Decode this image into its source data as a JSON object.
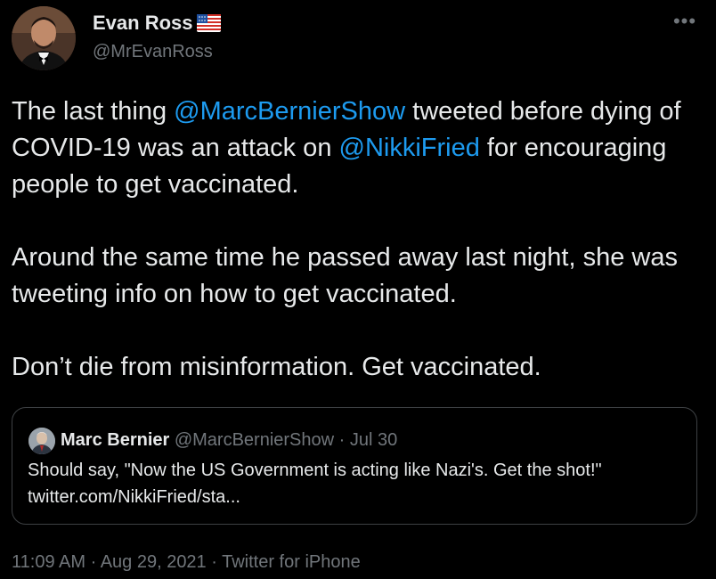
{
  "author": {
    "name": "Evan Ross",
    "handle": "@MrEvanRoss",
    "flag_icon": "us-flag-icon"
  },
  "menu": {
    "icon": "more-dots-icon",
    "glyph": "•••"
  },
  "body": {
    "p1": {
      "t1": "The last thing ",
      "m1": "@MarcBernierShow",
      "t2": " tweeted before dying of COVID-19 was an attack on ",
      "m2": "@NikkiFried",
      "t3": " for encouraging people to get vaccinated."
    },
    "p2": "Around the same time he passed away last night, she was tweeting info on how to get vaccinated.",
    "p3": "Don’t die from misinformation. Get vaccinated."
  },
  "quote": {
    "name": "Marc Bernier",
    "meta": " @MarcBernierShow · Jul 30",
    "text": "Should say, \"Now the US Government is acting like Nazi's. Get the shot!\" twitter.com/NikkiFried/sta..."
  },
  "footer": {
    "time": "11:09 AM · Aug 29, 2021 · ",
    "source": "Twitter for iPhone"
  },
  "colors": {
    "background": "#000000",
    "text": "#e7e9ea",
    "secondary": "#71767b",
    "mention": "#1d9bf0",
    "border": "#3e4144"
  }
}
